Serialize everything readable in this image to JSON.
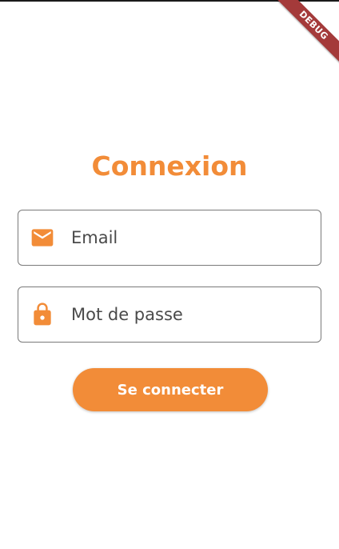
{
  "debug_banner": {
    "label": "DEBUG",
    "color": "#a43a3a"
  },
  "page": {
    "title": "Connexion",
    "accent_color": "#f28c38"
  },
  "form": {
    "email": {
      "placeholder": "Email",
      "icon": "email-icon"
    },
    "password": {
      "placeholder": "Mot de passe",
      "icon": "lock-icon"
    },
    "submit_label": "Se connecter"
  }
}
